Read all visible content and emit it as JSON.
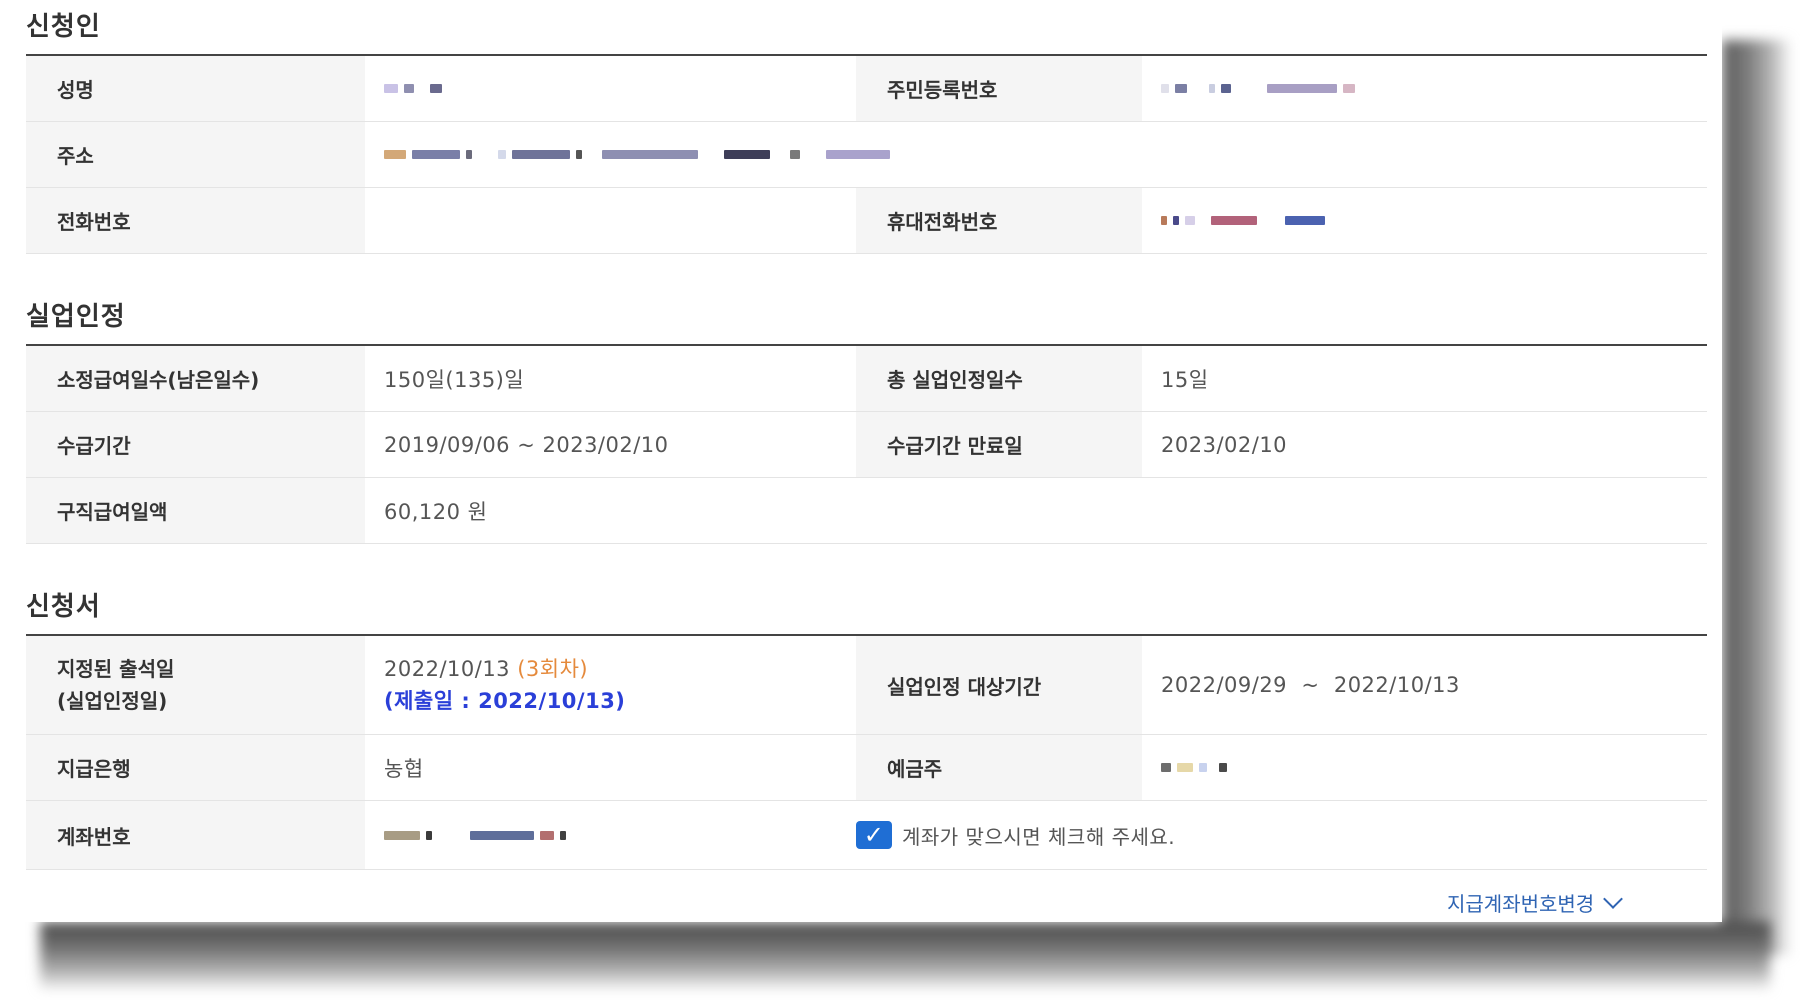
{
  "sections": {
    "applicant": {
      "title": "신청인",
      "labels": {
        "name": "성명",
        "resident_number": "주민등록번호",
        "address": "주소",
        "phone": "전화번호",
        "mobile": "휴대전화번호"
      }
    },
    "unemployment": {
      "title": "실업인정",
      "labels": {
        "benefit_days": "소정급여일수(남은일수)",
        "total_days": "총 실업인정일수",
        "benefit_period": "수급기간",
        "period_end": "수급기간 만료일",
        "daily_amount": "구직급여일액"
      },
      "values": {
        "benefit_days": "150일(135)일",
        "total_days": "15일",
        "benefit_period": "2019/09/06 ~ 2023/02/10",
        "period_end": "2023/02/10",
        "daily_amount": "60,120 원"
      }
    },
    "application": {
      "title": "신청서",
      "labels": {
        "attendance_line1": "지정된 출석일",
        "attendance_line2": "(실업인정일)",
        "target_period": "실업인정 대상기간",
        "bank": "지급은행",
        "depositor": "예금주",
        "account": "계좌번호"
      },
      "values": {
        "attendance_date": "2022/10/13",
        "attendance_round": "(3회차)",
        "submit_date": "(제출일 : 2022/10/13)",
        "target_period": "2022/09/29  ~  2022/10/13",
        "bank": "농협"
      },
      "confirm_checkbox": {
        "checked": true,
        "label": "계좌가 맞으시면 체크해 주세요."
      },
      "change_account_link": "지급계좌번호변경"
    }
  },
  "colors": {
    "header_bg": "#f5f5f5",
    "table_top_border": "#444444",
    "checkbox_blue": "#1f6ed4",
    "round_orange": "#e58a3c",
    "submit_blue": "#2a3fd8",
    "link_blue": "#2f64b3"
  }
}
